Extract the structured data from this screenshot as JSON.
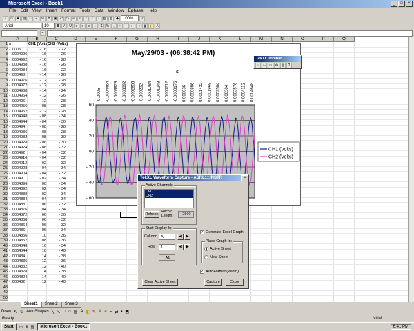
{
  "window": {
    "title": "Microsoft Excel - Book1"
  },
  "menu": [
    "File",
    "Edit",
    "View",
    "Insert",
    "Format",
    "Tools",
    "Data",
    "Window",
    "Epbase",
    "Help"
  ],
  "toolbar": {
    "zoom": "100%",
    "font": "Arial",
    "size": "10"
  },
  "formula": {
    "namebox": ""
  },
  "columns": [
    "A",
    "B",
    "C",
    "D",
    "E",
    "F",
    "G",
    "H",
    "I",
    "J",
    "K",
    "L",
    "M",
    "N",
    "O",
    "P",
    "Q"
  ],
  "table": {
    "headers": [
      "s",
      "CH1 (Volts)",
      "CH2 (Volts)"
    ],
    "rows": [
      [
        "- .0005",
        "- 16",
        "- 22"
      ],
      [
        "- .0004996",
        "- 16",
        "- 26"
      ],
      [
        "- .0004992",
        "- 16",
        "- 28"
      ],
      [
        "- .0004988",
        "- 16",
        "- 26"
      ],
      [
        "- .0004984",
        "- 16",
        "- 22"
      ],
      [
        "- .000498",
        "- 14",
        "- 26"
      ],
      [
        "- .0004976",
        "- 12",
        "- 28"
      ],
      [
        "- .0004972",
        "- 12",
        "- 28"
      ],
      [
        "- .0004968",
        "- 14",
        "- 24"
      ],
      [
        "- .0004964",
        "- 12",
        "- 26"
      ],
      [
        "- .000496",
        "- 12",
        "- 28"
      ],
      [
        "- .0004956",
        "- 08",
        "- 28"
      ],
      [
        "- .0004952",
        "- 12",
        "- 28"
      ],
      [
        "- .0004948",
        "- 08",
        "- 34"
      ],
      [
        "- .0004944",
        "- 04",
        "- 30"
      ],
      [
        "- .000494",
        "- 08",
        "- 28"
      ],
      [
        "- .0004936",
        "- 08",
        "- 28"
      ],
      [
        "- .0004932",
        "- 08",
        "- 30"
      ],
      [
        "- .0004928",
        "- 06",
        "- 30"
      ],
      [
        "- .0004924",
        "- 06",
        "- 32"
      ],
      [
        "- .000492",
        "- 04",
        "- 32"
      ],
      [
        "- .0004916",
        "- 04",
        "- 32"
      ],
      [
        "- .0004912",
        "- 02",
        "- 32"
      ],
      [
        "- .0004908",
        "- 04",
        "- 34"
      ],
      [
        "- .0004904",
        "- 04",
        "- 32"
      ],
      [
        "- .00049",
        "- 02",
        "- 34"
      ],
      [
        "- .0004896",
        "00",
        "- 34"
      ],
      [
        "- .0004892",
        "02",
        "- 34"
      ],
      [
        "- .0004888",
        "02",
        "- 34"
      ],
      [
        "- .0004884",
        "04",
        "- 34"
      ],
      [
        "- .000488",
        "06",
        "- 32"
      ],
      [
        "- .0004876",
        "04",
        "- 34"
      ],
      [
        "- .0004872",
        "06",
        "- 36"
      ],
      [
        "- .0004868",
        "06",
        "- 32"
      ],
      [
        "- .0004864",
        "06",
        "- 32"
      ],
      [
        "- .000486",
        "06",
        "- 34"
      ],
      [
        "- .0004856",
        "10",
        "- 36"
      ],
      [
        "- .0004852",
        "08",
        "- 36"
      ],
      [
        "- .0004848",
        "10",
        "- 34"
      ],
      [
        "- .0004844",
        "10",
        "- 40"
      ],
      [
        "- .000484",
        "14",
        "- 38"
      ],
      [
        "- .0004836",
        "12",
        "- 36"
      ],
      [
        "- .0004832",
        "12",
        "- 40"
      ],
      [
        "- .0004828",
        "14",
        "- 38"
      ],
      [
        "- .0004824",
        "14",
        "- 40"
      ],
      [
        "- .000482",
        "12",
        "- 40"
      ]
    ]
  },
  "chart_data": {
    "type": "line",
    "title": "May/29/03 - (06:38:42 PM)",
    "xlabel": "s",
    "x_ticks": [
      "-0.0005",
      "-0.0004464",
      "-0.0003928",
      "-0.0003392",
      "-0.0002856",
      "-0.000232",
      "-0.0001784",
      "-0.0001248",
      "-0.0000712",
      "-0.0000176",
      "0.000036",
      "0.0000896",
      "0.0001432",
      "0.0001968",
      "0.0002504",
      "0.000304",
      "0.0003576",
      "0.0004112",
      "0.0004648"
    ],
    "y_ticks": [
      "60",
      ".40",
      ".20",
      "00",
      "- 20",
      "- 40",
      "- 60"
    ],
    "ylim": [
      -0.6,
      0.6
    ],
    "legend_position": "right",
    "series": [
      {
        "name": "CH1 (Volts)",
        "color": "#1a1a8c",
        "amplitude": 0.42,
        "cycles": 11.0,
        "phase": 3.4
      },
      {
        "name": "CH2 (Volts)",
        "color": "#e040c8",
        "amplitude": 0.44,
        "cycles": 10.8,
        "phase": 1.8
      }
    ]
  },
  "toolbox": {
    "title": "TekXL Toolbar"
  },
  "dialog": {
    "title": "TekXL Waveform Capture - ASRL1::INSTR",
    "active_channels_label": "Active Channels",
    "channels": [
      "CH1",
      "CH2"
    ],
    "refresh": "Refresh",
    "record_length_label": "Record Length:",
    "record_length": "2500",
    "start_display_label": "Start Display In:",
    "column_label": "Column",
    "column_value": "A",
    "row_label": "Row",
    "row_value": "1",
    "cell_ref": "A1",
    "generate_graph": "Generate Excel Graph",
    "place_graph_label": "Place Graph In:",
    "active_sheet": "Active Sheet",
    "new_sheet": "New Sheet",
    "autoformat": "AutoFormat (Width)",
    "clear": "Clear Active Sheet",
    "capture": "Capture",
    "close": "Close"
  },
  "sheets": [
    "Sheet1",
    "Sheet2",
    "Sheet3"
  ],
  "drawbar": {
    "draw": "Draw",
    "autoshapes": "AutoShapes"
  },
  "status": {
    "left": "Ready",
    "num": "NUM"
  },
  "taskbar": {
    "start": "Start",
    "item": "Microsoft Excel - Book1",
    "clock": "6:41 PM"
  }
}
